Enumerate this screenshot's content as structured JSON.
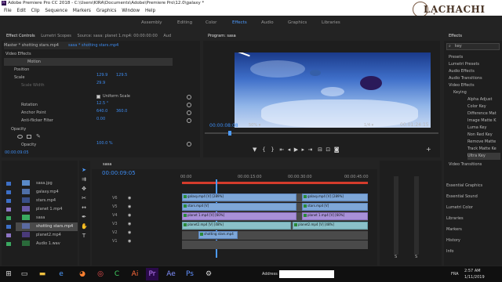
{
  "window": {
    "title": "Adobe Premiere Pro CC 2018 - C:\\Users\\KIRA\\Documents\\Adobe\\Premiere Pro\\12.0\\galaxy *",
    "logo_text": "LẠCHACHI",
    "logo_small": "TRUNG TÂM"
  },
  "menu": [
    "File",
    "Edit",
    "Clip",
    "Sequence",
    "Markers",
    "Graphics",
    "Window",
    "Help"
  ],
  "workspaces": {
    "items": [
      "Assembly",
      "Editing",
      "Color",
      "Effects",
      "Audio",
      "Graphics",
      "Libraries"
    ],
    "active": "Effects"
  },
  "effect_controls": {
    "tabs": [
      "Effect Controls",
      "Lumetri Scopes",
      "Source: sasa: planet 1.mp4: 00:00:00:00",
      "Aud"
    ],
    "active_tab": "Effect Controls",
    "master_label": "Master * shotting stars.mp4",
    "sequence_label": "sasa * shotting stars.mp4",
    "section_video": "Video Effects",
    "motion": "Motion",
    "position_label": "Position",
    "position_x": "129.9",
    "position_y": "129.5",
    "scale_label": "Scale",
    "scale_value": "29.9",
    "scale_width_label": "Scale Width",
    "uniform_scale": "Uniform Scale",
    "rotation_label": "Rotation",
    "rotation_value": "12.5 °",
    "anchor_label": "Anchor Point",
    "anchor_x": "640.0",
    "anchor_y": "360.0",
    "antiflicker_label": "Anti-flicker Filter",
    "antiflicker_value": "0.00",
    "opacity_section": "Opacity",
    "opacity_label": "Opacity",
    "opacity_value": "100.0 %",
    "timecode": "00:00:09:05"
  },
  "program_monitor": {
    "tab": "Program: sasa",
    "timecode": "00:00:08:08",
    "zoom": "50%",
    "fraction": "1/4",
    "duration": "00:01:24:15"
  },
  "effects_panel": {
    "tab": "Effects",
    "search_value": "key",
    "items": [
      "Presets",
      "Lumetri Presets",
      "Audio Effects",
      "Audio Transitions",
      "Video Effects",
      "Keying",
      "Alpha Adjust",
      "Color Key",
      "Difference Mat",
      "Image Matte K",
      "Luma Key",
      "Non Red Key",
      "Remove Matte",
      "Track Matte Ke",
      "Ultra Key",
      "Video Transitions"
    ],
    "bottom_panels": [
      "Essential Graphics",
      "Essential Sound",
      "Lumetri Color",
      "Libraries",
      "Markers",
      "History",
      "Info"
    ]
  },
  "project": {
    "files": [
      "sasa.jpg",
      "galaxy.mp4",
      "stars.mp4",
      "planet 1.mp4",
      "sasa",
      "shotting stars.mp4",
      "planet2.mp4",
      "Audio 1.wav"
    ]
  },
  "timeline": {
    "tab": "sasa",
    "timecode": "00:00:09:05",
    "ruler": [
      "00:00",
      "00:00:15:00",
      "00:00:30:00",
      "00:00:45:00"
    ],
    "tracks": [
      "V6",
      "V5",
      "V4",
      "V3",
      "V2",
      "V1"
    ],
    "clips": [
      {
        "label": "galaxy.mp4 [V] [289%]",
        "track": 0,
        "color": "blue"
      },
      {
        "label": "galaxy.mp4 [V] [289%]",
        "track": 0,
        "color": "blue"
      },
      {
        "label": "stars.mp4 [V]",
        "track": 1,
        "color": "blue"
      },
      {
        "label": "stars.mp4 [V]",
        "track": 1,
        "color": "blue"
      },
      {
        "label": "planet 1.mp4 [V] [60%]",
        "track": 2,
        "color": "violet"
      },
      {
        "label": "planet 1.mp4 [V] [60%]",
        "track": 2,
        "color": "violet"
      },
      {
        "label": "planet2.mp4 [V] [48%]",
        "track": 3,
        "color": "teal"
      },
      {
        "label": "planet2.mp4 [V] [48%]",
        "track": 3,
        "color": "teal"
      },
      {
        "label": "shotting stars.mp4",
        "track": 4,
        "color": "blue"
      }
    ],
    "audio_meter_labels": [
      "S",
      "S"
    ]
  },
  "taskbar": {
    "address_label": "Address",
    "lang": "FRA",
    "time": "2:57 AM",
    "date": "1/11/2019"
  }
}
